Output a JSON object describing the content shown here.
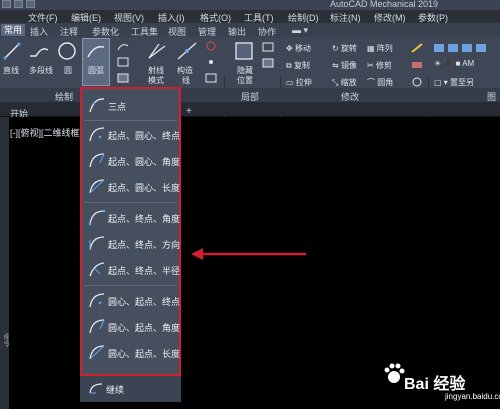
{
  "app_title": "AutoCAD Mechanical 2019",
  "menu": [
    "文件(F)",
    "编辑(E)",
    "视图(V)",
    "插入(I)",
    "格式(O)",
    "工具(T)",
    "绘制(D)",
    "标注(N)",
    "修改(M)",
    "参数(P)"
  ],
  "tabs": [
    "常用",
    "插入",
    "注释",
    "参数化",
    "工具集",
    "视图",
    "管理",
    "输出",
    "协作"
  ],
  "ribbon": {
    "line": "直线",
    "polyline": "多段线",
    "circle": "圆",
    "arc": "圆弧",
    "ray": "射线",
    "construction": "构造",
    "construction2": "线",
    "hatch_mode": "模式",
    "hide": "隐藏",
    "position": "位置",
    "move": "移动",
    "rotate": "旋转",
    "array": "阵列",
    "copy": "复制",
    "mirror": "镜像",
    "trim": "修剪",
    "stretch": "拉伸",
    "scale": "缩放",
    "fillet": "圆角",
    "am": "AM",
    "layer_to": "置至另"
  },
  "panels": {
    "draw": "绘制",
    "local": "局部",
    "modify": "修改",
    "layer": "图层"
  },
  "file_tab": "开始",
  "view_label": "[-][俯视][二维线框]",
  "side_text": "命令",
  "arc_menu": {
    "three_point": "三点",
    "start_center_end": "起点、圆心、终点",
    "start_center_angle": "起点、圆心、角度",
    "start_center_length": "起点、圆心、长度",
    "start_end_angle": "起点、终点、角度",
    "start_end_direction": "起点、终点、方向",
    "start_end_radius": "起点、终点、半径",
    "center_start_end": "圆心、起点、终点",
    "center_start_angle": "圆心、起点、角度",
    "center_start_length": "圆心、起点、长度",
    "continue": "继续"
  },
  "watermark": {
    "brand": "Bai 经验",
    "url": "jingyan.baidu.com"
  },
  "colors": {
    "highlight_border": "#d01f2f",
    "arrow": "#d01f2f"
  }
}
